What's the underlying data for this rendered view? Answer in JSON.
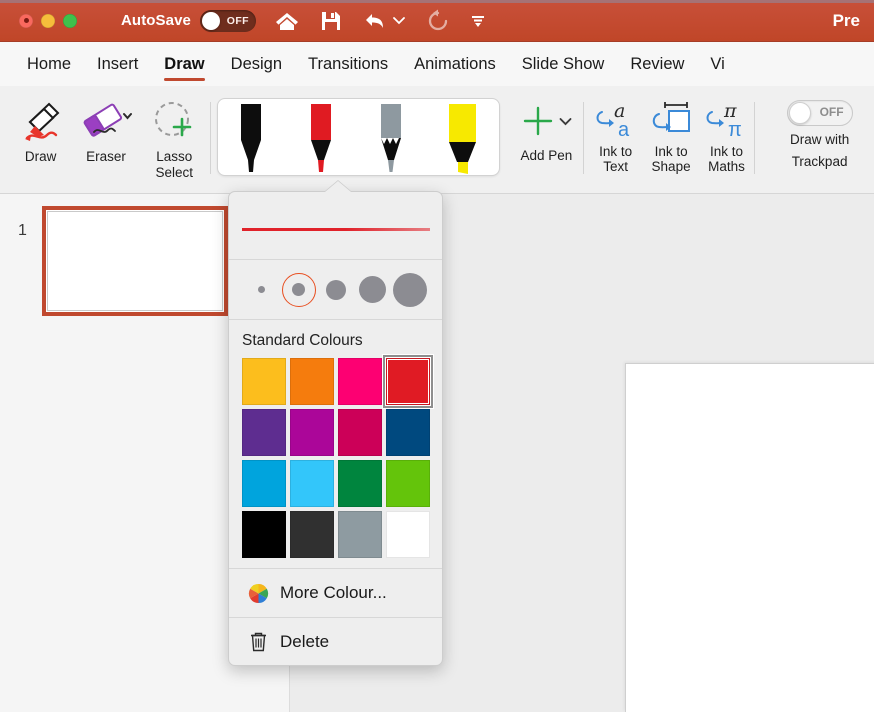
{
  "titlebar": {
    "autosave_label": "AutoSave",
    "autosave_state": "OFF",
    "doc_title": "Pre",
    "icons": [
      "home-icon",
      "save-icon",
      "undo-icon",
      "undo-chevron-icon",
      "redo-icon",
      "customize-toolbar-icon"
    ],
    "bg_color": "#c44a32"
  },
  "tabs": [
    {
      "label": "Home",
      "active": false
    },
    {
      "label": "Insert",
      "active": false
    },
    {
      "label": "Draw",
      "active": true
    },
    {
      "label": "Design",
      "active": false
    },
    {
      "label": "Transitions",
      "active": false
    },
    {
      "label": "Animations",
      "active": false
    },
    {
      "label": "Slide Show",
      "active": false
    },
    {
      "label": "Review",
      "active": false
    },
    {
      "label": "Vi",
      "active": false
    }
  ],
  "ribbon": {
    "draw_label": "Draw",
    "eraser_label": "Eraser",
    "lasso_label_1": "Lasso",
    "lasso_label_2": "Select",
    "add_pen_label": "Add Pen",
    "pens": [
      {
        "name": "black-pen",
        "body": "#0d0d0d",
        "tip": "#0d0d0d",
        "type": "pen",
        "selected": false
      },
      {
        "name": "red-pen",
        "body": "#e01b22",
        "tip": "#e01b22",
        "type": "pen",
        "selected": true
      },
      {
        "name": "grey-pencil",
        "body": "#8e99a0",
        "tip": "#8e99a0",
        "type": "pencil",
        "selected": false
      },
      {
        "name": "yellow-highlighter",
        "body": "#f7e900",
        "tip": "#f7e900",
        "type": "highlighter",
        "selected": false
      }
    ],
    "ink_to_text_1": "Ink to",
    "ink_to_text_2": "Text",
    "ink_to_shape_1": "Ink to",
    "ink_to_shape_2": "Shape",
    "ink_to_maths_1": "Ink to",
    "ink_to_maths_2": "Maths",
    "trackpad_state": "OFF",
    "trackpad_label_1": "Draw with",
    "trackpad_label_2": "Trackpad"
  },
  "slides": {
    "thumb_number": "1"
  },
  "popover": {
    "preview_color": "#e0222a",
    "thickness": {
      "sizes": [
        7,
        13,
        20,
        27,
        34
      ],
      "selected_index": 1,
      "dot_color": "#8c8c92",
      "ring_color": "#e84f21"
    },
    "colours_header": "Standard Colours",
    "swatches": [
      {
        "name": "swatch-gold",
        "hex": "#fcbe1d",
        "selected": false
      },
      {
        "name": "swatch-orange",
        "hex": "#f57c0d",
        "selected": false
      },
      {
        "name": "swatch-pink",
        "hex": "#fd0072",
        "selected": false
      },
      {
        "name": "swatch-red",
        "hex": "#e01b24",
        "selected": true
      },
      {
        "name": "swatch-purple",
        "hex": "#5e2d90",
        "selected": false
      },
      {
        "name": "swatch-magenta",
        "hex": "#ab0699",
        "selected": false
      },
      {
        "name": "swatch-crimson",
        "hex": "#cc0058",
        "selected": false
      },
      {
        "name": "swatch-dark-blue",
        "hex": "#00497f",
        "selected": false
      },
      {
        "name": "swatch-cyan-blue",
        "hex": "#00a4dd",
        "selected": false
      },
      {
        "name": "swatch-light-blue",
        "hex": "#33c6fa",
        "selected": false
      },
      {
        "name": "swatch-green",
        "hex": "#00853e",
        "selected": false
      },
      {
        "name": "swatch-lime",
        "hex": "#64c40b",
        "selected": false
      },
      {
        "name": "swatch-black",
        "hex": "#000000",
        "selected": false
      },
      {
        "name": "swatch-dark-grey",
        "hex": "#303030",
        "selected": false
      },
      {
        "name": "swatch-blue-grey",
        "hex": "#8e9ba1",
        "selected": false
      },
      {
        "name": "swatch-white",
        "hex": "#ffffff",
        "selected": false
      }
    ],
    "more_colours_label": "More Colour...",
    "delete_label": "Delete"
  }
}
